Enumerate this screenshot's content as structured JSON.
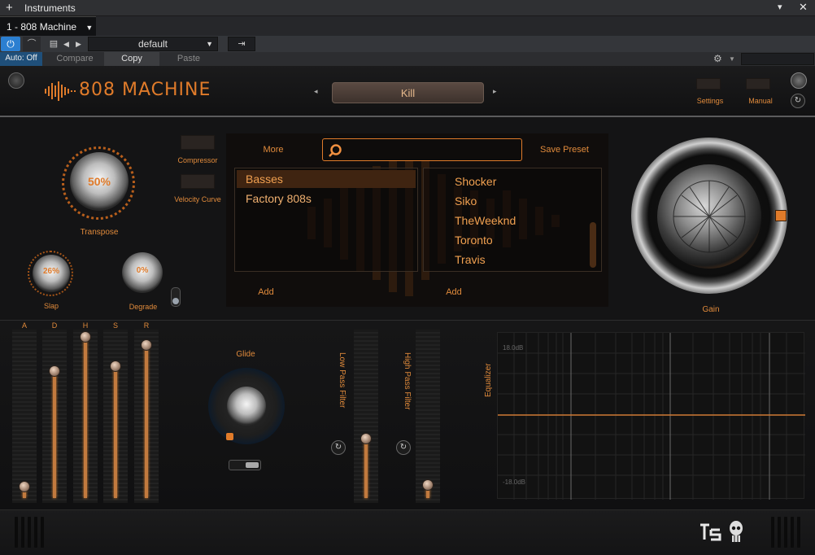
{
  "host": {
    "window_title": "Instruments",
    "instrument_tab": "1 - 808 Machine",
    "preset_dropdown": "default",
    "auto": "Auto: Off",
    "compare": "Compare",
    "copy": "Copy",
    "paste": "Paste"
  },
  "plugin": {
    "logo": "808 MACHINE",
    "preset_name": "Kill",
    "settings": "Settings",
    "manual": "Manual",
    "compressor": "Compressor",
    "velocity_curve": "Velocity Curve",
    "transpose": {
      "label": "Transpose",
      "value": "50%"
    },
    "slap": {
      "label": "Slap",
      "value": "26%"
    },
    "degrade": {
      "label": "Degrade",
      "value": "0%"
    },
    "gain": {
      "label": "Gain"
    },
    "glide": {
      "label": "Glide"
    }
  },
  "browser": {
    "more": "More",
    "save_preset": "Save Preset",
    "search_placeholder": "",
    "categories": [
      "Basses",
      "Factory 808s"
    ],
    "presets": [
      "Shocker",
      "Siko",
      "TheWeeknd",
      "Toronto",
      "Travis"
    ],
    "add_left": "Add",
    "add_right": "Add"
  },
  "adsr": {
    "labels": [
      "A",
      "D",
      "H",
      "S",
      "R"
    ],
    "values": [
      0.07,
      0.77,
      0.98,
      0.8,
      0.93
    ]
  },
  "filters": {
    "lowpass": {
      "label": "Low Pass Filter",
      "value": 0.36
    },
    "highpass": {
      "label": "High Pass Filter",
      "value": 0.08
    }
  },
  "equalizer": {
    "label": "Equalizer",
    "top": "18.0dB",
    "bottom": "-18.0dB"
  },
  "colors": {
    "accent": "#e07b2a",
    "background": "#141415"
  }
}
